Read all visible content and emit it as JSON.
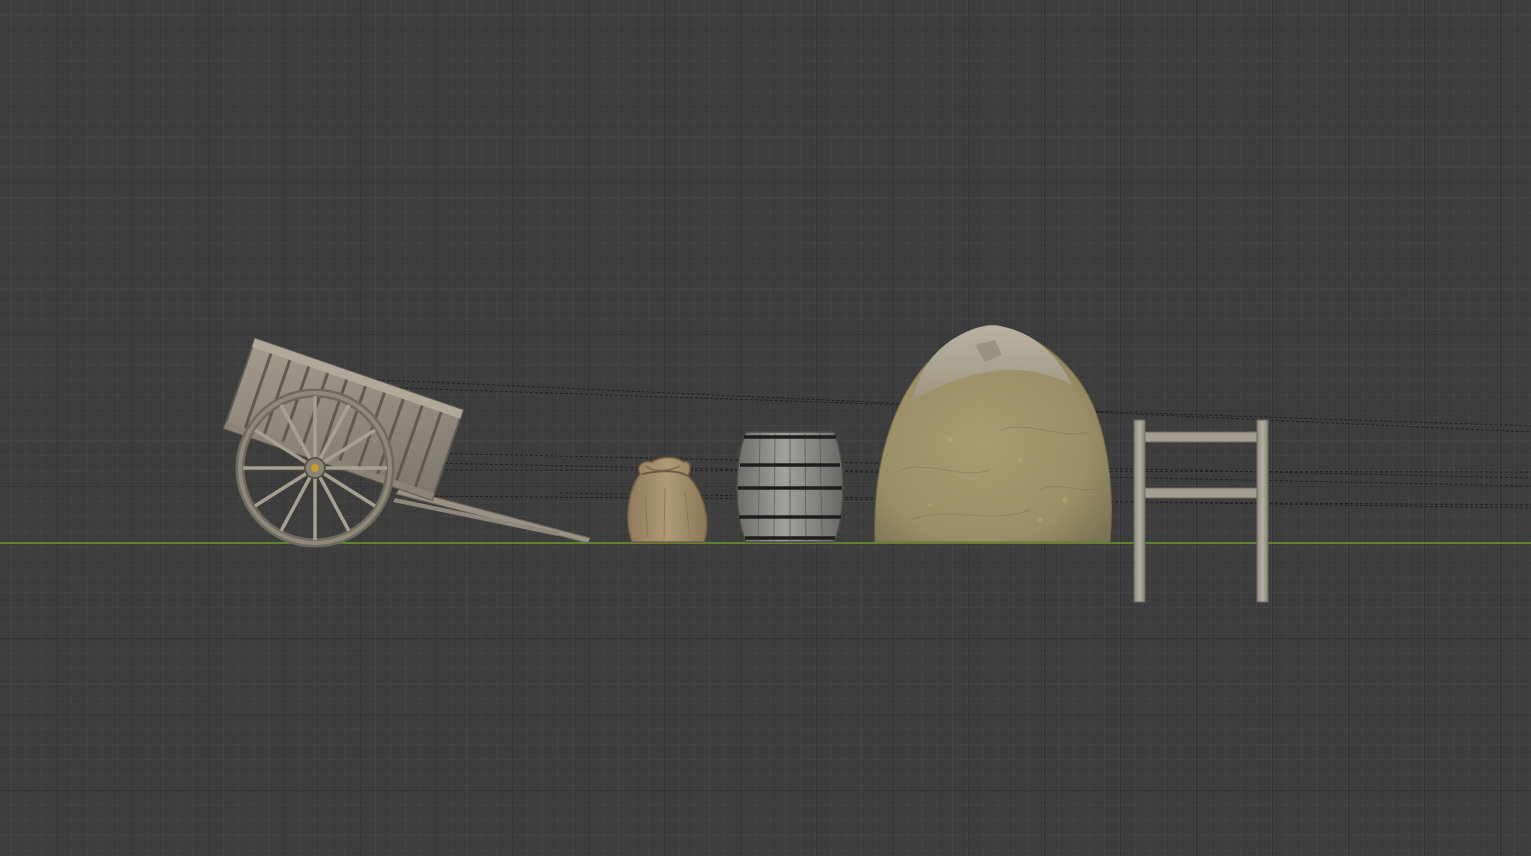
{
  "viewport": {
    "view": "orthographic-front",
    "background_color": "#3d3d3d",
    "grid_color": "#353535",
    "ground_axis_color": "#6a9a2a"
  },
  "objects": [
    {
      "id": "cart",
      "kind": "wooden-cart",
      "color": "#8f877a"
    },
    {
      "id": "sack",
      "kind": "burlap-sack",
      "color": "#a38e6c"
    },
    {
      "id": "barrel",
      "kind": "wooden-barrel",
      "color": "#8a8884"
    },
    {
      "id": "haystack",
      "kind": "haystack",
      "color": "#a79c77"
    },
    {
      "id": "fence",
      "kind": "wooden-fence",
      "color": "#a29d8f"
    }
  ],
  "guide_lines": {
    "style": "dashed",
    "color": "#1e1e1e",
    "count": 7
  }
}
